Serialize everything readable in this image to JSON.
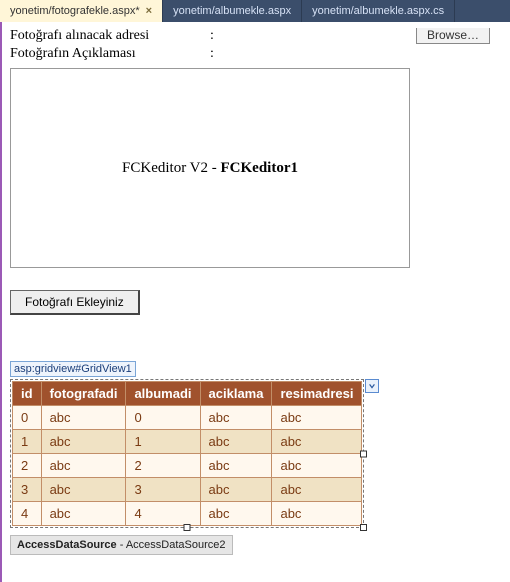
{
  "tabs": [
    {
      "label": "yonetim/fotografekle.aspx*",
      "active": true
    },
    {
      "label": "yonetim/albumekle.aspx",
      "active": false
    },
    {
      "label": "yonetim/albumekle.aspx.cs",
      "active": false
    }
  ],
  "form": {
    "row1_label": "Fotoğrafı alınacak adresi",
    "row2_label": "Fotoğrafın Açıklaması",
    "colon": ":",
    "browse_label": "Browse…"
  },
  "fck": {
    "prefix": "FCKeditor V2 - ",
    "name": "FCKeditor1"
  },
  "buttons": {
    "add_photo": "Fotoğrafı Ekleyiniz"
  },
  "grid": {
    "tag": "asp:gridview#GridView1",
    "headers": [
      "id",
      "fotografadi",
      "albumadi",
      "aciklama",
      "resimadresi"
    ],
    "rows": [
      [
        "0",
        "abc",
        "0",
        "abc",
        "abc"
      ],
      [
        "1",
        "abc",
        "1",
        "abc",
        "abc"
      ],
      [
        "2",
        "abc",
        "2",
        "abc",
        "abc"
      ],
      [
        "3",
        "abc",
        "3",
        "abc",
        "abc"
      ],
      [
        "4",
        "abc",
        "4",
        "abc",
        "abc"
      ]
    ]
  },
  "datasource": {
    "type": "AccessDataSource",
    "sep": " - ",
    "name": "AccessDataSource2"
  }
}
